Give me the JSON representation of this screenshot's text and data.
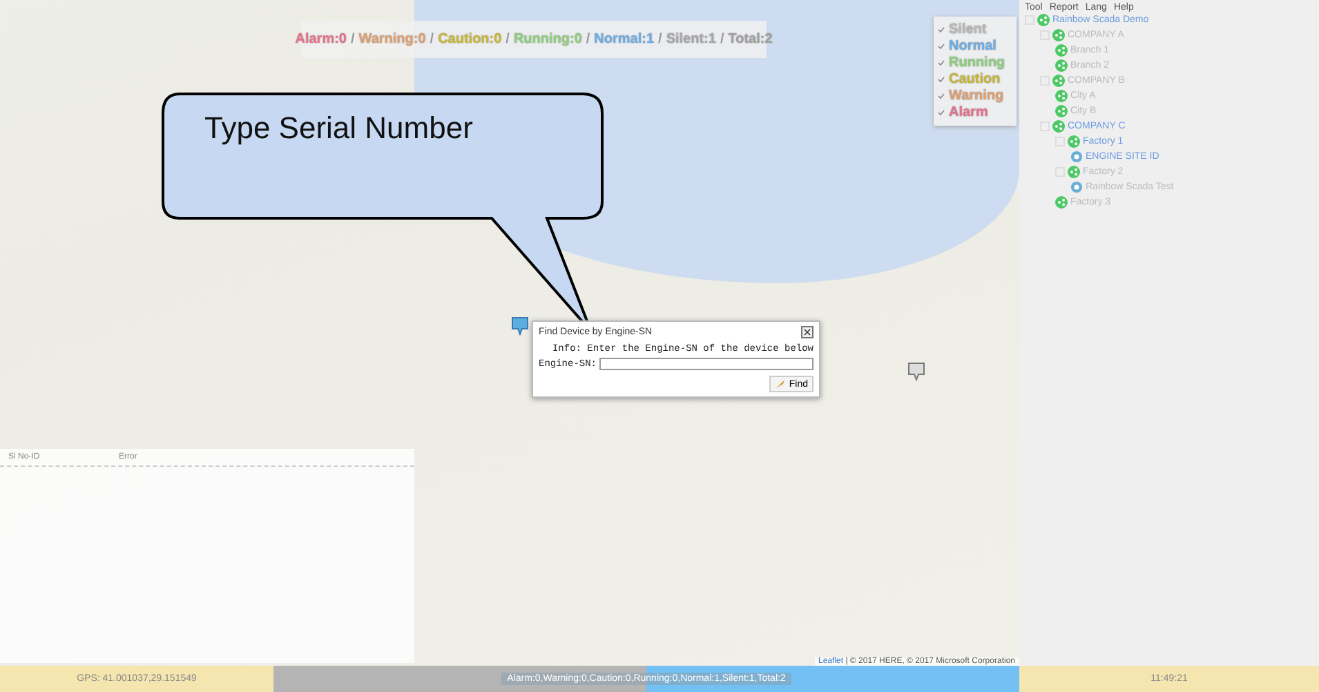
{
  "summary_separator": "/",
  "summary": [
    {
      "label": "Alarm:0",
      "color": "#e8708a"
    },
    {
      "label": "Warning:0",
      "color": "#e0a070"
    },
    {
      "label": "Caution:0",
      "color": "#c8b830"
    },
    {
      "label": "Running:0",
      "color": "#8cd07c"
    },
    {
      "label": "Normal:1",
      "color": "#6aaee8"
    },
    {
      "label": "Silent:1",
      "color": "#a8a8a8"
    },
    {
      "label": "Total:2",
      "color": "#a0a0a0"
    }
  ],
  "legend": [
    {
      "label": "Silent",
      "color": "#b8b8b8",
      "checked": true
    },
    {
      "label": "Normal",
      "color": "#6aaee8",
      "checked": true
    },
    {
      "label": "Running",
      "color": "#8cd07c",
      "checked": true
    },
    {
      "label": "Caution",
      "color": "#c8b830",
      "checked": true
    },
    {
      "label": "Warning",
      "color": "#e0a070",
      "checked": true
    },
    {
      "label": "Alarm",
      "color": "#e8708a",
      "checked": true
    }
  ],
  "callout": {
    "text": "Type Serial Number"
  },
  "dialog": {
    "title": "Find Device by Engine-SN",
    "info": "Info: Enter the Engine-SN of the device below",
    "field_label": "Engine-SN:",
    "button": "Find"
  },
  "panel": {
    "columns": [
      "Sl No-ID",
      "Error"
    ]
  },
  "attribution": {
    "link": "Leaflet",
    "text": "| © 2017 HERE, © 2017 Microsoft Corporation"
  },
  "menu": [
    "Tool",
    "Report",
    "Lang",
    "Help"
  ],
  "tree": [
    {
      "label": "Rainbow Scada Demo",
      "kind": "group",
      "active": true,
      "children": [
        {
          "label": "COMPANY A",
          "kind": "group",
          "active": false,
          "children": [
            {
              "label": "Branch 1",
              "kind": "group",
              "active": false
            },
            {
              "label": "Branch 2",
              "kind": "group",
              "active": false
            }
          ]
        },
        {
          "label": "COMPANY B",
          "kind": "group",
          "active": false,
          "children": [
            {
              "label": "City A",
              "kind": "group",
              "active": false
            },
            {
              "label": "City B",
              "kind": "group",
              "active": false
            }
          ]
        },
        {
          "label": "COMPANY C",
          "kind": "group",
          "active": true,
          "children": [
            {
              "label": "Factory 1",
              "kind": "group",
              "active": true,
              "children": [
                {
                  "label": "ENGINE SITE ID",
                  "kind": "device",
                  "active": true
                }
              ]
            },
            {
              "label": "Factory 2",
              "kind": "group",
              "active": false,
              "children": [
                {
                  "label": "Rainbow Scada Test",
                  "kind": "device",
                  "active": false
                }
              ]
            },
            {
              "label": "Factory 3",
              "kind": "group",
              "active": false
            }
          ]
        }
      ]
    }
  ],
  "status_bar": {
    "gps": "GPS: 41.001037,29.151549",
    "summary": "Alarm:0,Warning:0,Caution:0,Running:0,Normal:1,Silent:1,Total:2",
    "time": "11:49:21"
  }
}
